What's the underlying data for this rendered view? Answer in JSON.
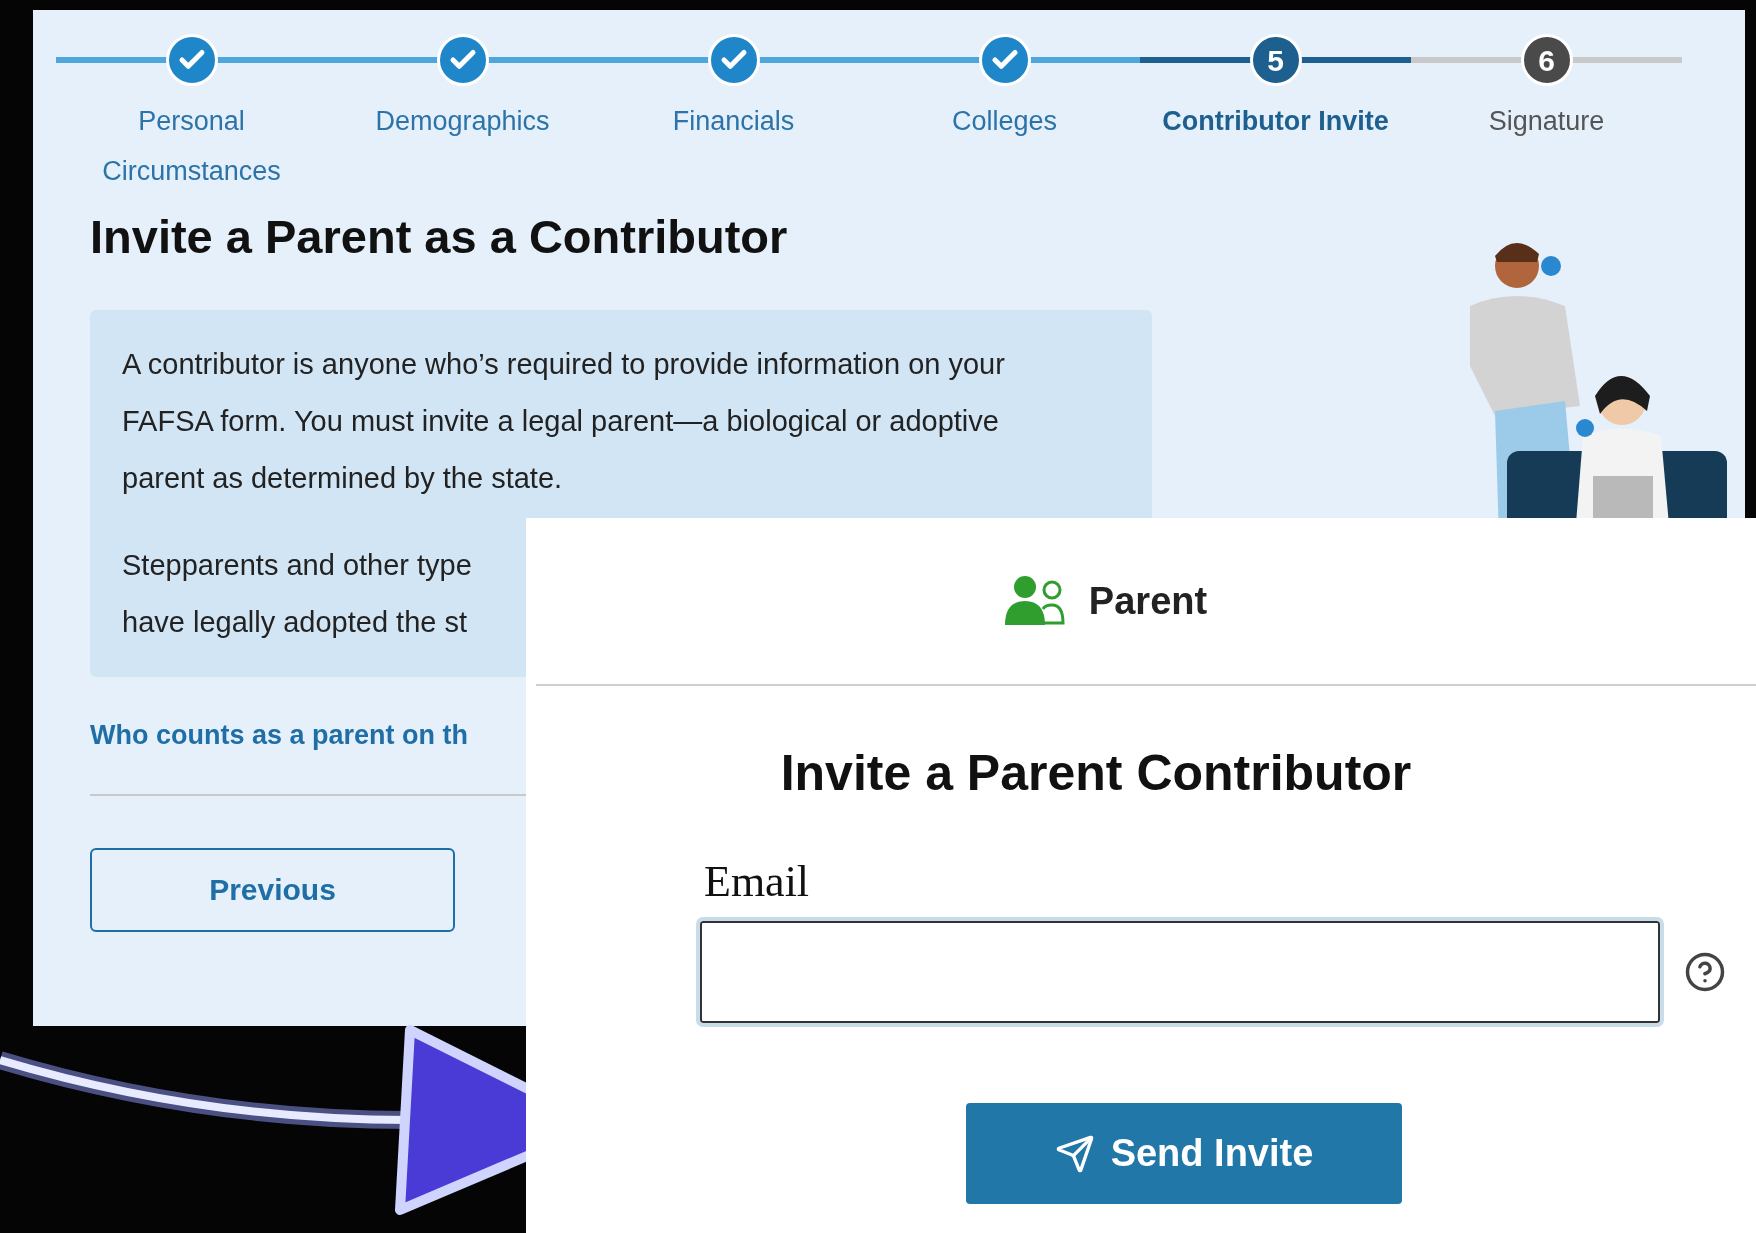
{
  "steps": [
    {
      "label": "Personal Circumstances",
      "completed": true,
      "selected": false
    },
    {
      "label": "Demographics",
      "completed": true,
      "selected": false
    },
    {
      "label": "Financials",
      "completed": true,
      "selected": false
    },
    {
      "label": "Colleges",
      "completed": true,
      "selected": false
    },
    {
      "label": "Contributor Invite",
      "completed": false,
      "selected": true,
      "number": "5"
    },
    {
      "label": "Signature",
      "completed": false,
      "selected": false,
      "number": "6"
    }
  ],
  "heading": "Invite a Parent as a Contributor",
  "info_box": {
    "paragraphs": [
      {
        "lines": [
          "A contributor is anyone who’s required to provide information on your FAFSA form. You must invite a legal parent—a biological or adoptive parent as determined by the state."
        ]
      },
      {
        "lines": [
          "Stepparents and other type",
          "have legally adopted the st"
        ]
      }
    ]
  },
  "link": "Who counts as a parent on th",
  "previous_button": "Previous",
  "invite_panel": {
    "tab": "Parent",
    "title": "Invite a Parent Contributor",
    "email_label": "Email",
    "send_button": "Send Invite"
  }
}
